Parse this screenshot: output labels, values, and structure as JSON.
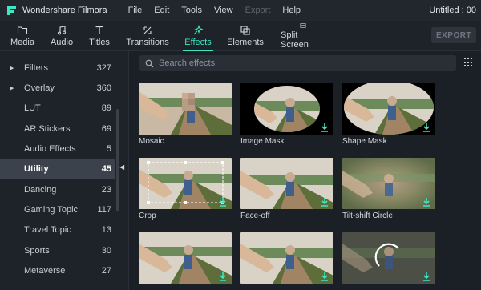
{
  "app": {
    "title": "Wondershare Filmora",
    "project_title": "Untitled : 00",
    "menu": [
      "File",
      "Edit",
      "Tools",
      "View",
      "Export",
      "Help"
    ]
  },
  "toolbar": {
    "tabs": [
      {
        "label": "Media",
        "icon": "folder-icon"
      },
      {
        "label": "Audio",
        "icon": "music-note-icon"
      },
      {
        "label": "Titles",
        "icon": "text-t-icon"
      },
      {
        "label": "Transitions",
        "icon": "transition-icon"
      },
      {
        "label": "Effects",
        "icon": "sparkle-icon",
        "active": true
      },
      {
        "label": "Elements",
        "icon": "elements-icon"
      },
      {
        "label": "Split Screen",
        "icon": "split-screen-icon"
      }
    ],
    "export_label": "EXPORT",
    "accent": "#3ee6c4"
  },
  "sidebar": {
    "items": [
      {
        "label": "Filters",
        "count": "327",
        "expandable": true
      },
      {
        "label": "Overlay",
        "count": "360",
        "expandable": true
      },
      {
        "label": "LUT",
        "count": "89"
      },
      {
        "label": "AR Stickers",
        "count": "69"
      },
      {
        "label": "Audio Effects",
        "count": "5"
      },
      {
        "label": "Utility",
        "count": "45",
        "selected": true
      },
      {
        "label": "Dancing",
        "count": "23"
      },
      {
        "label": "Gaming Topic",
        "count": "117"
      },
      {
        "label": "Travel Topic",
        "count": "13"
      },
      {
        "label": "Sports",
        "count": "30"
      },
      {
        "label": "Metaverse",
        "count": "27"
      }
    ]
  },
  "search": {
    "placeholder": "Search effects"
  },
  "effects": [
    {
      "label": "Mosaic",
      "style": "mosaic",
      "download": false
    },
    {
      "label": "Image Mask",
      "style": "image-mask",
      "download": true
    },
    {
      "label": "Shape Mask",
      "style": "shape-mask",
      "download": true
    },
    {
      "label": "Crop",
      "style": "crop",
      "download": true
    },
    {
      "label": "Face-off",
      "style": "face-off",
      "download": true
    },
    {
      "label": "Tilt-shift Circle",
      "style": "tilt-shift",
      "download": true
    },
    {
      "label": "",
      "style": "plain",
      "download": true
    },
    {
      "label": "",
      "style": "plain",
      "download": true
    },
    {
      "label": "",
      "style": "loading",
      "download": true
    }
  ]
}
